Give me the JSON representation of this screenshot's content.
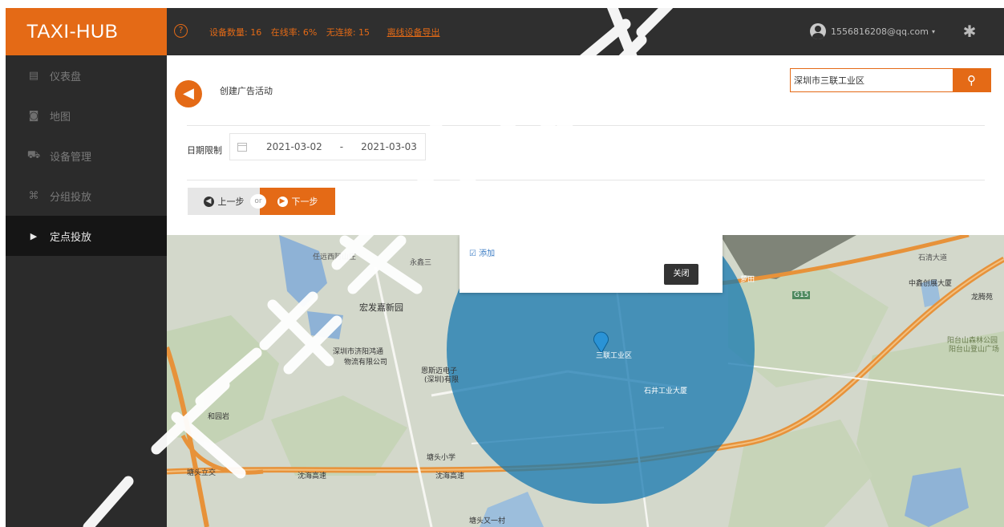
{
  "app": {
    "brand": "TAXI-HUB"
  },
  "header": {
    "help_icon": "?",
    "device_count": "设备数量: 16",
    "online_rate": "在线率: 6%",
    "no_connection": "无连接: 15",
    "export_link": "离线设备导出",
    "user_email": "1556816208@qq.com",
    "caret": "▾",
    "gear_icon": "✱"
  },
  "sidebar": {
    "items": [
      {
        "icon": "▤",
        "label": "仪表盘"
      },
      {
        "icon": "◙",
        "label": "地图"
      },
      {
        "icon": "⛟",
        "label": "设备管理"
      },
      {
        "icon": "⌘",
        "label": "分组投放"
      },
      {
        "icon": "▶",
        "label": "定点投放"
      }
    ]
  },
  "panel": {
    "back_icon": "◀",
    "title": "创建广告活动",
    "search_value": "深圳市三联工业区",
    "search_icon": "⚲",
    "date_label": "日期限制",
    "date_start": "2021-03-02",
    "date_sep": "-",
    "date_end": "2021-03-03",
    "prev_icon": "◀",
    "prev_label": "上一步",
    "or_label": "or",
    "next_icon": "▶",
    "next_label": "下一步"
  },
  "popup": {
    "add_label": "☑ 添加",
    "close_label": "关闭"
  },
  "map": {
    "labels": {
      "l1": "任远西阿山庄",
      "l2": "永鑫三",
      "l3": "宏发嘉新园",
      "l4": "深圳市济阳鸿通",
      "l5": "物流有限公司",
      "l6": "恩斯迈电子",
      "l7": "(深圳)有限",
      "l8": "三联工业区",
      "l9": "石井工业大厦",
      "l10": "和园岩",
      "l11": "塘头小学",
      "l12": "塘头立交",
      "l13": "沈海高速",
      "l14": "沈海高速",
      "l15": "塘头又一村",
      "l16": "中鑫创展大厦",
      "l17": "龙腾苑",
      "l18": "阳台山森林公园",
      "l19": "阳台山登山广场",
      "l20": "石清大道",
      "l21": "G15",
      "l22": "萝田"
    }
  }
}
